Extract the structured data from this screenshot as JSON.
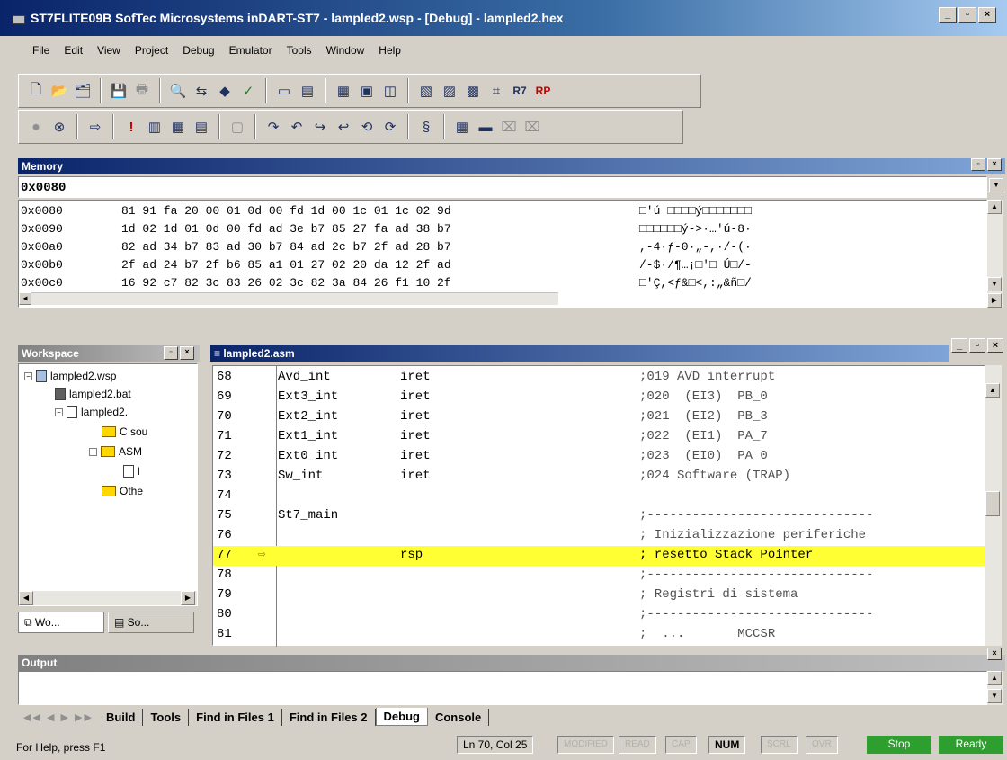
{
  "window": {
    "title": "ST7FLITE09B SofTec Microsystems  inDART-ST7 - lampled2.wsp - [Debug] - lampled2.hex",
    "controls": [
      "_",
      "▫",
      "×"
    ]
  },
  "menu": [
    "File",
    "Edit",
    "View",
    "Project",
    "Debug",
    "Emulator",
    "Tools",
    "Window",
    "Help"
  ],
  "toolbar1": [
    "new-file-icon",
    "open-icon",
    "open-project-icon",
    "save-icon",
    "print-icon",
    "find-icon",
    "replace-icon",
    "erase-icon",
    "check-icon",
    "window-icon",
    "output-icon",
    "memory-icon",
    "registers-icon",
    "watch-icon",
    "stack-icon",
    "disasm-icon",
    "variables-icon",
    "target-icon",
    "r7-icon",
    "rp-icon"
  ],
  "toolbar2": [
    "stop-icon",
    "reset-icon",
    "run-icon",
    "breakpoint-icon",
    "step-icon",
    "go-icon",
    "trace-icon",
    "step-into-icon",
    "step-over-icon",
    "step-out-icon",
    "run-to-icon",
    "animate-icon",
    "halt-icon",
    "watch-window-icon",
    "memory-window-icon",
    "calc-icon",
    "print2-icon"
  ],
  "memory": {
    "caption": "Memory",
    "address": "0x0080",
    "rows": [
      {
        "addr": "0x0080",
        "bytes": "81 91 fa 20 00 01 0d 00 fd 1d 00 1c 01 1c 02 9d",
        "ascii": "□'ú □□□□ý□□□□□□□"
      },
      {
        "addr": "0x0090",
        "bytes": "1d 02 1d 01 0d 00 fd ad 3e b7 85 27 fa ad 38 b7",
        "ascii": "□□□□□□ý->·…'ú-8·"
      },
      {
        "addr": "0x00a0",
        "bytes": "82 ad 34 b7 83 ad 30 b7 84 ad 2c b7 2f ad 28 b7",
        "ascii": ",-4·ƒ-0·„-,·/-(·"
      },
      {
        "addr": "0x00b0",
        "bytes": "2f ad 24 b7 2f b6 85 a1 01 27 02 20 da 12 2f ad",
        "ascii": "/-$·/¶…¡□'□ Ú□/-"
      },
      {
        "addr": "0x00c0",
        "bytes": "16 92 c7 82 3c 83 26 02 3c 82 3a 84 26 f1 10 2f",
        "ascii": "□'Ç,<ƒ&□<,:„&ñ□/"
      }
    ]
  },
  "workspace": {
    "caption": "Workspace",
    "items": [
      {
        "label": "lampled2.wsp",
        "indent": 0,
        "icon": "workspace-icon",
        "expander": "−"
      },
      {
        "label": "lampled2.bat",
        "indent": 1,
        "icon": "batch-file-icon",
        "expander": ""
      },
      {
        "label": "lampled2.",
        "indent": 1,
        "icon": "project-icon",
        "expander": "−"
      },
      {
        "label": "C sou",
        "indent": 2,
        "icon": "folder-icon",
        "expander": ""
      },
      {
        "label": "ASM",
        "indent": 2,
        "icon": "folder-icon",
        "expander": "−"
      },
      {
        "label": "l",
        "indent": 3,
        "icon": "asm-file-icon",
        "expander": ""
      },
      {
        "label": "Othe",
        "indent": 2,
        "icon": "folder-icon",
        "expander": ""
      }
    ],
    "tabs": [
      "Wo...",
      "So..."
    ]
  },
  "editor": {
    "title": "lampled2.asm",
    "lines": [
      {
        "num": "68",
        "label": "Avd_int",
        "instr": "iret",
        "comment": ";019 AVD interrupt"
      },
      {
        "num": "69",
        "label": "Ext3_int",
        "instr": "iret",
        "comment": ";020  (EI3)  PB_0"
      },
      {
        "num": "70",
        "label": "Ext2_int",
        "instr": "iret",
        "comment": ";021  (EI2)  PB_3"
      },
      {
        "num": "71",
        "label": "Ext1_int",
        "instr": "iret",
        "comment": ";022  (EI1)  PA_7"
      },
      {
        "num": "72",
        "label": "Ext0_int",
        "instr": "iret",
        "comment": ";023  (EI0)  PA_0"
      },
      {
        "num": "73",
        "label": "Sw_int",
        "instr": "iret",
        "comment": ";024 Software (TRAP)"
      },
      {
        "num": "74",
        "label": "",
        "instr": "",
        "comment": ""
      },
      {
        "num": "75",
        "label": "St7_main",
        "instr": "",
        "comment": ";------------------------------"
      },
      {
        "num": "76",
        "label": "",
        "instr": "",
        "comment": "; Inizializzazione periferiche"
      },
      {
        "num": "77",
        "label": "",
        "instr": "rsp",
        "comment": "; resetto Stack Pointer"
      },
      {
        "num": "78",
        "label": "",
        "instr": "",
        "comment": ";------------------------------"
      },
      {
        "num": "79",
        "label": "",
        "instr": "",
        "comment": "; Registri di sistema"
      },
      {
        "num": "80",
        "label": "",
        "instr": "",
        "comment": ";------------------------------"
      },
      {
        "num": "81",
        "label": "",
        "instr": "",
        "comment": ";  ...       MCCSR"
      }
    ],
    "current_line_index": 9,
    "current_arrow": "⇨"
  },
  "output": {
    "caption": "Output",
    "tabs": [
      "Build",
      "Tools",
      "Find in Files 1",
      "Find in Files 2",
      "Debug",
      "Console"
    ],
    "active_tab": "Debug"
  },
  "status": {
    "help": "For Help, press F1",
    "position": "Ln 70, Col 25",
    "indicators": [
      "MODIFIED",
      "READ",
      "CAP",
      "NUM",
      "SCRL",
      "OVR"
    ],
    "num": "NUM",
    "stop": "Stop",
    "ready": "Ready"
  }
}
